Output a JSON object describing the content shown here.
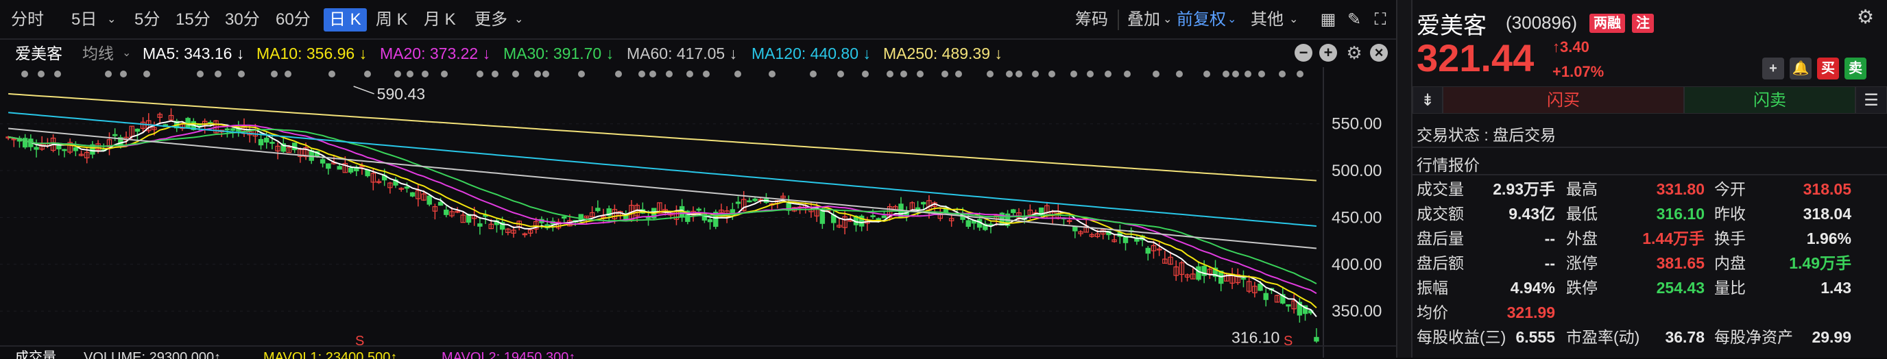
{
  "toolbar": {
    "periods": [
      "分时",
      "5日",
      "5分",
      "15分",
      "30分",
      "60分",
      "日 K",
      "周 K",
      "月 K",
      "更多"
    ],
    "active": "日 K",
    "right": [
      "筹码",
      "叠加",
      "前复权",
      "其他"
    ]
  },
  "stock": {
    "name": "爱美客",
    "indicator": "均线",
    "ma": [
      {
        "label": "MA5: 343.16 ↓",
        "color": "#ffffff"
      },
      {
        "label": "MA10: 356.96 ↓",
        "color": "#f5e60f"
      },
      {
        "label": "MA20: 373.22 ↓",
        "color": "#e23be0"
      },
      {
        "label": "MA30: 391.70 ↓",
        "color": "#3ad35a"
      },
      {
        "label": "MA60: 417.05 ↓",
        "color": "#c8c8c8"
      },
      {
        "label": "MA120: 440.80 ↓",
        "color": "#29c7e8"
      },
      {
        "label": "MA250: 489.39 ↓",
        "color": "#f3e27a"
      }
    ]
  },
  "chart_data": {
    "type": "candlestick",
    "y_ticks": [
      "550.00",
      "500.00",
      "450.00",
      "400.00",
      "350.00"
    ],
    "ylim": [
      315,
      590
    ],
    "high_label": "590.43",
    "low_label": "316.10",
    "markers": [
      "S",
      "S"
    ],
    "ma_end_values": {
      "MA5": 343.16,
      "MA10": 356.96,
      "MA20": 373.22,
      "MA30": 391.7,
      "MA60": 417.05,
      "MA120": 440.8,
      "MA250": 489.39
    }
  },
  "volume_bar": {
    "title": "成交量",
    "vol": "VOLUME: 29300.000↑",
    "mavol1": "MAVOL1: 23400.500↑",
    "mavol2": "MAVOL2: 19450.300↑"
  },
  "quote": {
    "name": "爱美客",
    "code": "(300896)",
    "badge1": "两融",
    "badge2": "注",
    "price": "321.44",
    "change": "↑3.40",
    "change_pct": "+1.07%",
    "buy_label": "闪买",
    "sell_label": "闪卖",
    "btn_buy": "买",
    "btn_sell": "卖",
    "status": "交易状态 : 盘后交易",
    "section": "行情报价",
    "rows": [
      [
        [
          "成交量",
          "2.93万手",
          "white"
        ],
        [
          "最高",
          "331.80",
          "red"
        ],
        [
          "今开",
          "318.05",
          "red"
        ]
      ],
      [
        [
          "成交额",
          "9.43亿",
          "white"
        ],
        [
          "最低",
          "316.10",
          "green"
        ],
        [
          "昨收",
          "318.04",
          "white"
        ]
      ],
      [
        [
          "盘后量",
          "--",
          "white"
        ],
        [
          "外盘",
          "1.44万手",
          "red"
        ],
        [
          "换手",
          "1.96%",
          "white"
        ]
      ],
      [
        [
          "盘后额",
          "--",
          "white"
        ],
        [
          "涨停",
          "381.65",
          "red"
        ],
        [
          "内盘",
          "1.49万手",
          "green"
        ]
      ],
      [
        [
          "振幅",
          "4.94%",
          "white"
        ],
        [
          "跌停",
          "254.43",
          "green"
        ],
        [
          "量比",
          "1.43",
          "white"
        ]
      ],
      [
        [
          "均价",
          "321.99",
          "red"
        ],
        [
          "",
          "",
          " white"
        ],
        [
          "",
          "",
          " white"
        ]
      ],
      [
        [
          "每股收益(三)",
          "6.555",
          "white"
        ],
        [
          "市盈率(动)",
          "36.78",
          "white"
        ],
        [
          "每股净资产",
          "29.99",
          "white"
        ]
      ]
    ]
  }
}
